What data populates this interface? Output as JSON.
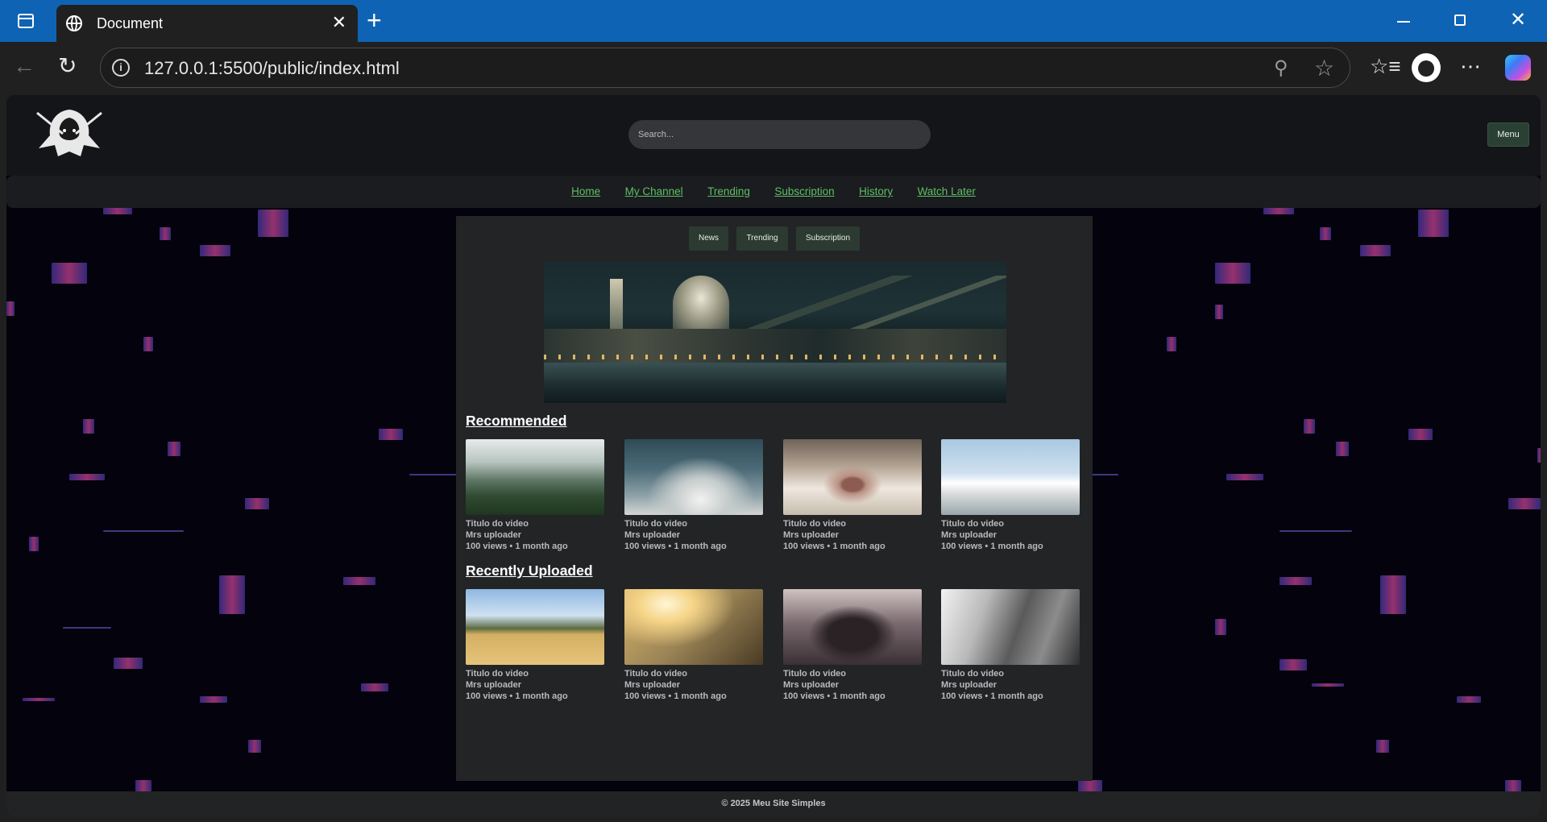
{
  "browser": {
    "tab_title": "Document",
    "url": "127.0.0.1:5500/public/index.html",
    "new_tab_glyph": "+",
    "close_glyph": "✕"
  },
  "site": {
    "search_placeholder": "Search...",
    "menu_label": "Menu",
    "nav": [
      "Home",
      "My Channel",
      "Trending",
      "Subscription",
      "History",
      "Watch Later"
    ],
    "filters": [
      "News",
      "Trending",
      "Subscription"
    ],
    "sections": [
      {
        "title": "Recommended",
        "videos": [
          {
            "title": "Titulo do video",
            "uploader": "Mrs uploader",
            "stats": "100 views • 1 month ago",
            "thumb": "misty-forest"
          },
          {
            "title": "Titulo do video",
            "uploader": "Mrs uploader",
            "stats": "100 views • 1 month ago",
            "thumb": "clouds"
          },
          {
            "title": "Titulo do video",
            "uploader": "Mrs uploader",
            "stats": "100 views • 1 month ago",
            "thumb": "cat-nose"
          },
          {
            "title": "Titulo do video",
            "uploader": "Mrs uploader",
            "stats": "100 views • 1 month ago",
            "thumb": "santorini"
          }
        ]
      },
      {
        "title": "Recently Uploaded",
        "videos": [
          {
            "title": "Titulo do video",
            "uploader": "Mrs uploader",
            "stats": "100 views • 1 month ago",
            "thumb": "field-sneakers"
          },
          {
            "title": "Titulo do video",
            "uploader": "Mrs uploader",
            "stats": "100 views • 1 month ago",
            "thumb": "sunlight-grass"
          },
          {
            "title": "Titulo do video",
            "uploader": "Mrs uploader",
            "stats": "100 views • 1 month ago",
            "thumb": "vintage-car"
          },
          {
            "title": "Titulo do video",
            "uploader": "Mrs uploader",
            "stats": "100 views • 1 month ago",
            "thumb": "mountains-bw"
          }
        ]
      }
    ],
    "footer": "© 2025 Meu Site Simples"
  },
  "colors": {
    "chrome_blue": "#0e63b4",
    "nav_link": "#5fbf62",
    "button_green": "#2a4034"
  }
}
